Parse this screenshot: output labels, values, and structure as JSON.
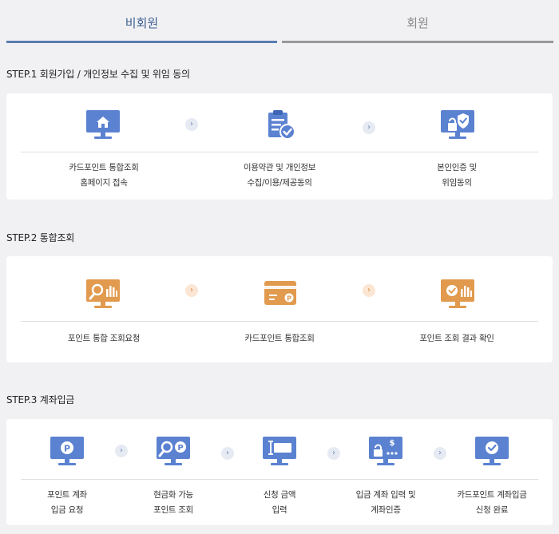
{
  "tabs": [
    {
      "label": "비회원",
      "active": true
    },
    {
      "label": "회원",
      "active": false
    }
  ],
  "colors": {
    "blue": "#5b82d1",
    "orange": "#e19a4e",
    "active_tab": "#5a7cb1"
  },
  "steps": [
    {
      "title": "STEP.1 회원가입 / 개인정보 수집 및 위임 동의",
      "items": [
        {
          "icon": "monitor-home-icon",
          "lines": [
            "카드포인트 통합조회",
            "홈페이지 접속"
          ]
        },
        {
          "icon": "clipboard-check-icon",
          "lines": [
            "이용약관 및 개인정보",
            "수집/이용/제공동의"
          ]
        },
        {
          "icon": "monitor-lock-shield-icon",
          "lines": [
            "본인인증 및",
            "위임동의"
          ]
        }
      ]
    },
    {
      "title": "STEP.2 통합조회",
      "items": [
        {
          "icon": "monitor-search-chart-icon",
          "lines": [
            "포인트 통합 조회요청"
          ]
        },
        {
          "icon": "card-point-icon",
          "lines": [
            "카드포인트 통합조회"
          ]
        },
        {
          "icon": "monitor-check-chart-icon",
          "lines": [
            "포인트 조회 결과 확인"
          ]
        }
      ]
    },
    {
      "title": "STEP.3 계좌입금",
      "items": [
        {
          "icon": "monitor-point-icon",
          "lines": [
            "포인트 계좌",
            "입금 요청"
          ]
        },
        {
          "icon": "monitor-search-point-icon",
          "lines": [
            "현금화 가능",
            "포인트 조회"
          ]
        },
        {
          "icon": "monitor-amount-input-icon",
          "lines": [
            "신청 금액",
            "입력"
          ]
        },
        {
          "icon": "monitor-account-auth-icon",
          "lines": [
            "입금 계좌 입력 및",
            "계좌인증"
          ]
        },
        {
          "icon": "monitor-check-icon",
          "lines": [
            "카드포인트 계좌입금",
            "신청 완료"
          ]
        }
      ]
    }
  ],
  "arrow_glyph": "›"
}
